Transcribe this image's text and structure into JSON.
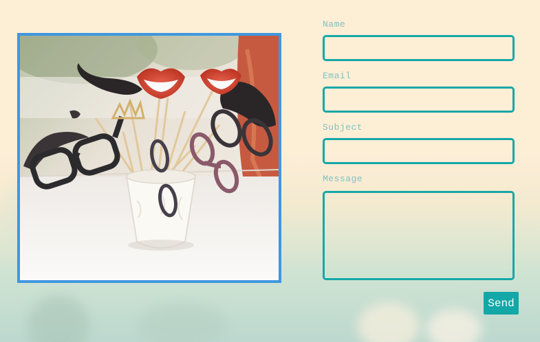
{
  "photo": {
    "alt": "Photo booth props: paper mustaches, lips and glasses on sticks in a white cup"
  },
  "form": {
    "fields": [
      {
        "label": "Name",
        "value": "",
        "placeholder": ""
      },
      {
        "label": "Email",
        "value": "",
        "placeholder": ""
      },
      {
        "label": "Subject",
        "value": "",
        "placeholder": ""
      },
      {
        "label": "Message",
        "value": "",
        "placeholder": ""
      }
    ],
    "send_label": "Send"
  },
  "colors": {
    "accent": "#14a7a7",
    "label": "#7fc2c0",
    "frame": "#3f97e0",
    "background": "#fdeed6"
  }
}
